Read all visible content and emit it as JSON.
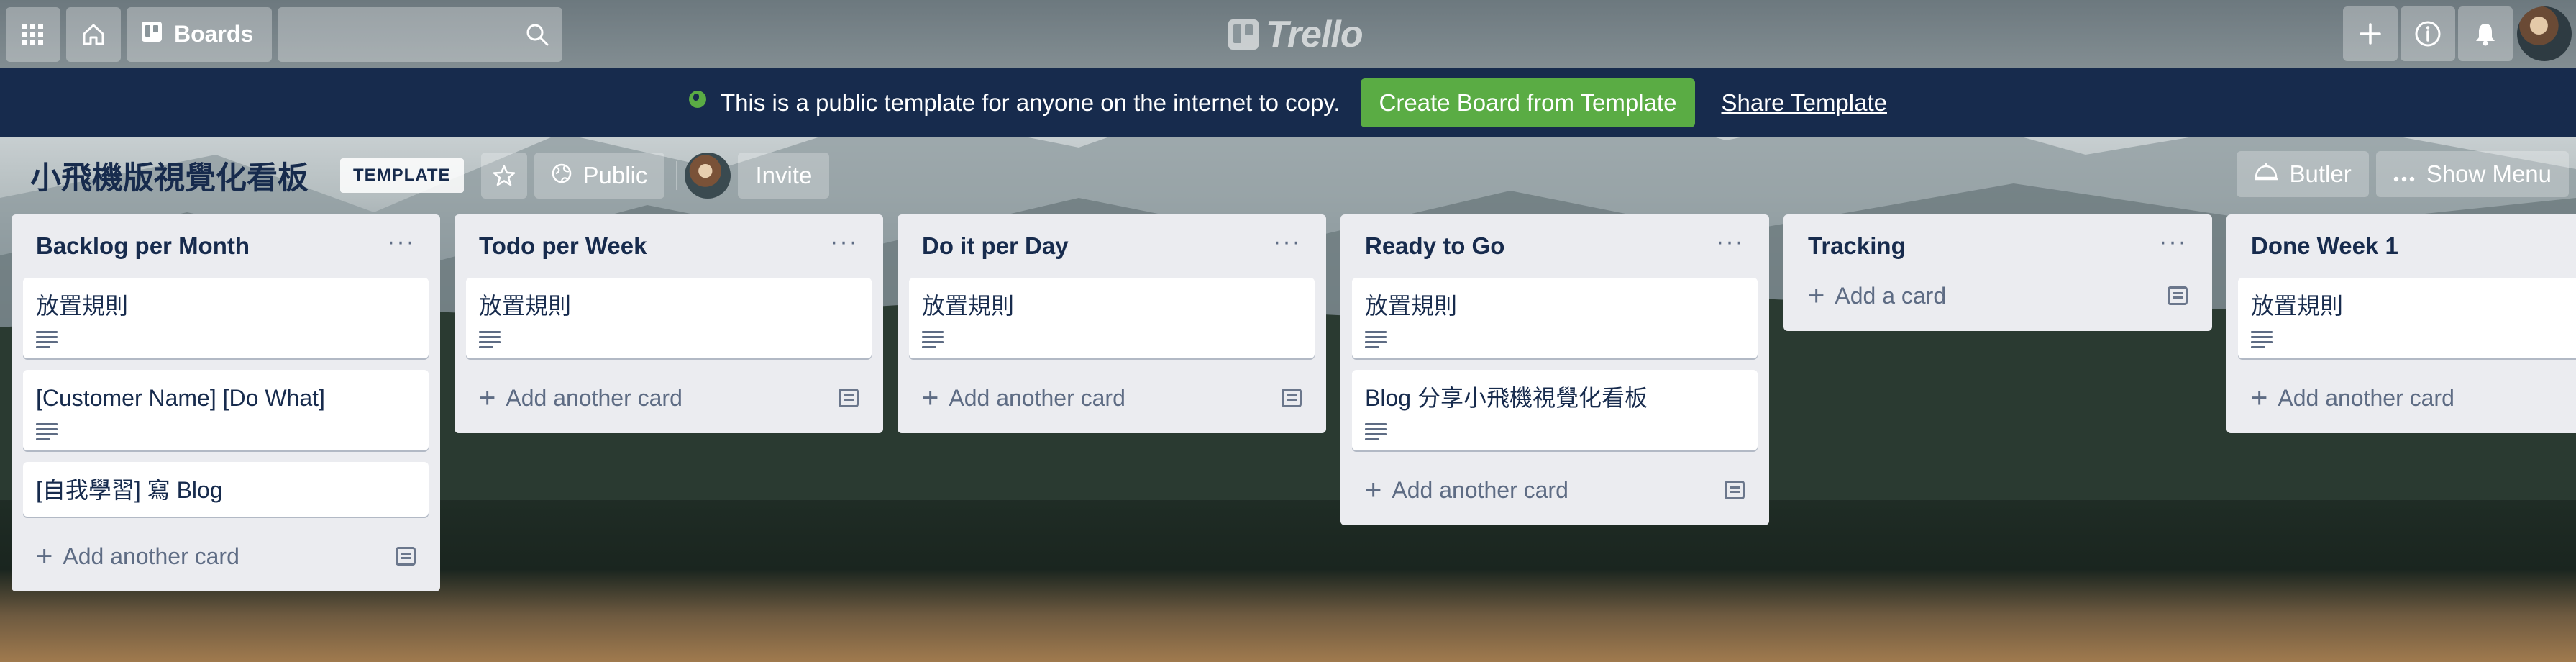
{
  "header": {
    "boards_label": "Boards",
    "logo_text": "Trello"
  },
  "banner": {
    "message": "This is a public template for anyone on the internet to copy.",
    "create_label": "Create Board from Template",
    "share_label": "Share Template"
  },
  "board": {
    "title": "小飛機版視覺化看板",
    "template_badge": "TEMPLATE",
    "visibility_label": "Public",
    "invite_label": "Invite",
    "butler_label": "Butler",
    "show_menu_label": "Show Menu"
  },
  "lists": [
    {
      "title": "Backlog per Month",
      "cards": [
        {
          "title": "放置規則",
          "has_desc": true
        },
        {
          "title": "[Customer Name] [Do What]",
          "has_desc": true
        },
        {
          "title": "[自我學習] 寫 Blog",
          "has_desc": false
        }
      ],
      "composer_label": "Add another card"
    },
    {
      "title": "Todo per Week",
      "cards": [
        {
          "title": "放置規則",
          "has_desc": true
        }
      ],
      "composer_label": "Add another card"
    },
    {
      "title": "Do it per Day",
      "cards": [
        {
          "title": "放置規則",
          "has_desc": true
        }
      ],
      "composer_label": "Add another card"
    },
    {
      "title": "Ready to Go",
      "cards": [
        {
          "title": "放置規則",
          "has_desc": true
        },
        {
          "title": "Blog 分享小飛機視覺化看板",
          "has_desc": true
        }
      ],
      "composer_label": "Add another card"
    },
    {
      "title": "Tracking",
      "cards": [],
      "composer_label": "Add a card"
    },
    {
      "title": "Done Week 1",
      "cards": [
        {
          "title": "放置規則",
          "has_desc": true
        }
      ],
      "composer_label": "Add another card"
    }
  ],
  "colors": {
    "banner_bg": "#172b4d",
    "create_button": "#5aac44",
    "list_bg": "#ebecf0"
  }
}
